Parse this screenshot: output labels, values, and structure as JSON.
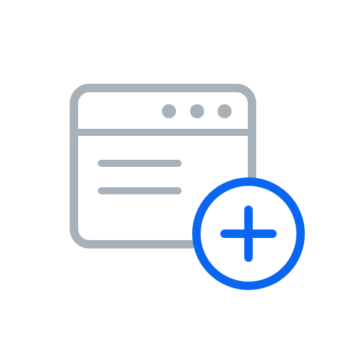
{
  "icon": {
    "name": "add-window-icon",
    "parts": {
      "window": "browser-window-icon",
      "dots": "window-controls-dots",
      "lines": "content-lines",
      "add": "plus-circle-icon"
    }
  },
  "colors": {
    "background": "#ffffff",
    "window_stroke": "#a7b1ba",
    "accent": "#0a66f0"
  }
}
